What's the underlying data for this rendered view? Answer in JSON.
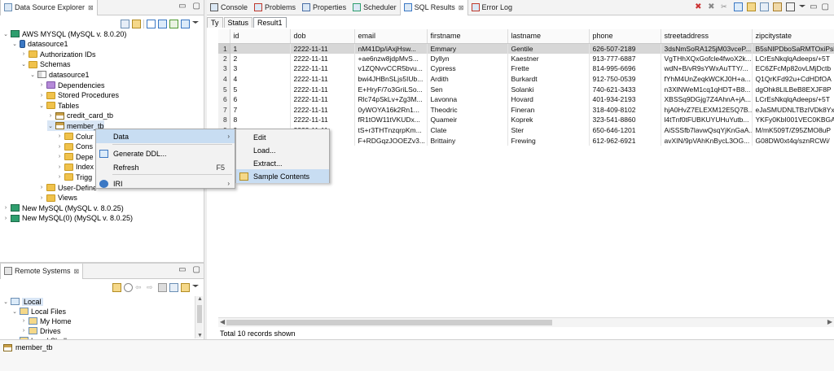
{
  "left_panel": {
    "title": "Data Source Explorer",
    "close_glyph": "⊠",
    "tree": [
      {
        "label": "AWS MYSQL (MySQL v. 8.0.20)",
        "indent": 0,
        "twisty": "v",
        "icon": "server"
      },
      {
        "label": "datasource1",
        "indent": 1,
        "twisty": "v",
        "icon": "database"
      },
      {
        "label": "Authorization IDs",
        "indent": 2,
        "twisty": ">",
        "icon": "folder"
      },
      {
        "label": "Schemas",
        "indent": 2,
        "twisty": "v",
        "icon": "folder"
      },
      {
        "label": "datasource1",
        "indent": 3,
        "twisty": "v",
        "icon": "schema"
      },
      {
        "label": "Dependencies",
        "indent": 4,
        "twisty": ">",
        "icon": "folder-purple"
      },
      {
        "label": "Stored Procedures",
        "indent": 4,
        "twisty": ">",
        "icon": "folder"
      },
      {
        "label": "Tables",
        "indent": 4,
        "twisty": "v",
        "icon": "folder"
      },
      {
        "label": "credit_card_tb",
        "indent": 5,
        "twisty": ">",
        "icon": "table"
      },
      {
        "label": "member_tb",
        "indent": 5,
        "twisty": "v",
        "icon": "table",
        "selected": true
      },
      {
        "label": "Colur",
        "indent": 6,
        "twisty": ">",
        "icon": "folder"
      },
      {
        "label": "Cons",
        "indent": 6,
        "twisty": ">",
        "icon": "folder"
      },
      {
        "label": "Depe",
        "indent": 6,
        "twisty": ">",
        "icon": "folder"
      },
      {
        "label": "Index",
        "indent": 6,
        "twisty": ">",
        "icon": "folder"
      },
      {
        "label": "Trigg",
        "indent": 6,
        "twisty": ">",
        "icon": "folder"
      },
      {
        "label": "User-Define",
        "indent": 4,
        "twisty": ">",
        "icon": "folder"
      },
      {
        "label": "Views",
        "indent": 4,
        "twisty": ">",
        "icon": "folder"
      },
      {
        "label": "New MySQL (MySQL v. 8.0.25)",
        "indent": 0,
        "twisty": ">",
        "icon": "server"
      },
      {
        "label": "New MySQL(0) (MySQL v. 8.0.25)",
        "indent": 0,
        "twisty": ">",
        "icon": "server"
      }
    ]
  },
  "remote_panel": {
    "title": "Remote Systems",
    "tree": [
      {
        "label": "Local",
        "indent": 0,
        "twisty": "v",
        "selected": true
      },
      {
        "label": "Local Files",
        "indent": 1,
        "twisty": "v"
      },
      {
        "label": "My Home",
        "indent": 2,
        "twisty": ">"
      },
      {
        "label": "Drives",
        "indent": 2,
        "twisty": ">"
      },
      {
        "label": "Local Shells",
        "indent": 1,
        "twisty": ""
      }
    ]
  },
  "top_tabs": [
    {
      "label": "Console",
      "active": false
    },
    {
      "label": "Problems",
      "active": false
    },
    {
      "label": "Properties",
      "active": false
    },
    {
      "label": "Scheduler",
      "active": false
    },
    {
      "label": "SQL Results",
      "active": true
    },
    {
      "label": "Error Log",
      "active": false
    }
  ],
  "result_tabs": [
    {
      "label": "Ty",
      "active": false
    },
    {
      "label": "Status",
      "active": false
    },
    {
      "label": "Result1",
      "active": true
    }
  ],
  "grid": {
    "columns": [
      "",
      "id",
      "dob",
      "email",
      "firstname",
      "lastname",
      "phone",
      "streetaddress",
      "zipcitystate"
    ],
    "rows": [
      [
        "1",
        "1",
        "2222-11-11",
        "nM41Dp/iAxjHsw...",
        "Emmary",
        "Gentile",
        "626-507-2189",
        "3dsNmSoRA125jM03vceP...",
        "B5sNIPDboSaRMTOxiPsl"
      ],
      [
        "2",
        "2",
        "2222-11-11",
        "+ae6nzw8jdpMvS...",
        "Dyllyn",
        "Kaestner",
        "913-777-6887",
        "VgTHhXQxGofcle4fwoX2k...",
        "LCrEsNkqlqAdeeps/+5T"
      ],
      [
        "3",
        "3",
        "2222-11-11",
        "v1ZQNvvCCR5bvu...",
        "Cypress",
        "Frette",
        "814-995-6696",
        "wdN+B/vR9sYWxAuTTY/...",
        "EC6ZFcMp82ovLMjDctb"
      ],
      [
        "4",
        "4",
        "2222-11-11",
        "bwi4JHBnSLjs5IUb...",
        "Ardith",
        "Burkardt",
        "912-750-0539",
        "fYhM4UnZeqkWCKJ0H+a...",
        "Q1QrKFd92u+CdHDfOA"
      ],
      [
        "5",
        "5",
        "2222-11-11",
        "E+HryF/7o3GriLSo...",
        "Sen",
        "Solanki",
        "740-621-3433",
        "n3XlNWeM1cq1qHDT+B8...",
        "dgOhk8LlLBeB8EXJF8P"
      ],
      [
        "6",
        "6",
        "2222-11-11",
        "Rlc74pSkLv+Zg3M...",
        "Lavonna",
        "Hovard",
        "401-934-2193",
        "XBSSq9DGjg7Z4AhnA+jA...",
        "LCrEsNkqlqAdeeps/+5T"
      ],
      [
        "7",
        "7",
        "2222-11-11",
        "0yWOYA16k2Rn1...",
        "Theodric",
        "Fineran",
        "318-409-8102",
        "hjA0HvZ7ELEXM12E5Q7B...",
        "eJaSMUDNLTBzIVDk8Yx"
      ],
      [
        "8",
        "8",
        "2222-11-11",
        "fR1tOW11tVKUDx...",
        "Quameir",
        "Koprek",
        "323-541-8860",
        "l4tTnf0tFUBKUYUHuYutb...",
        "YKFy0KbI001VEC0KBGA"
      ],
      [
        "9",
        "9",
        "2222-11-11",
        "tS+r3THTnzqrpKm...",
        "Clate",
        "Ster",
        "650-646-1201",
        "AiSSSfb7lavwQsqYjKnGaA...",
        "M/mK509T/Z95ZMO8uP"
      ],
      [
        "10",
        "10",
        "2222-11-11",
        "F+RDGqzJOOEZv3...",
        "Brittainy",
        "Frewing",
        "612-962-6921",
        "avXIN/9pVAhKnBycL3OG...",
        "G08DW0xt4q/sznRCWi/"
      ]
    ],
    "status": "Total 10 records shown"
  },
  "context_menu": {
    "items": [
      {
        "label": "Data",
        "submenu": true,
        "highlighted": true
      },
      {
        "label": "Generate DDL...",
        "icon": "ddl"
      },
      {
        "label": "Refresh",
        "shortcut": "F5"
      },
      {
        "label": "IRI",
        "submenu": true,
        "icon": "iri"
      }
    ]
  },
  "submenu": {
    "items": [
      {
        "label": "Edit"
      },
      {
        "label": "Load..."
      },
      {
        "label": "Extract..."
      },
      {
        "label": "Sample Contents",
        "highlighted": true
      }
    ]
  },
  "statusbar": {
    "label": "member_tb"
  },
  "colors": {
    "selection": "#c8ddf2",
    "grid_highlight_row": "#d7d7d7",
    "folder": "#f0c24c"
  }
}
